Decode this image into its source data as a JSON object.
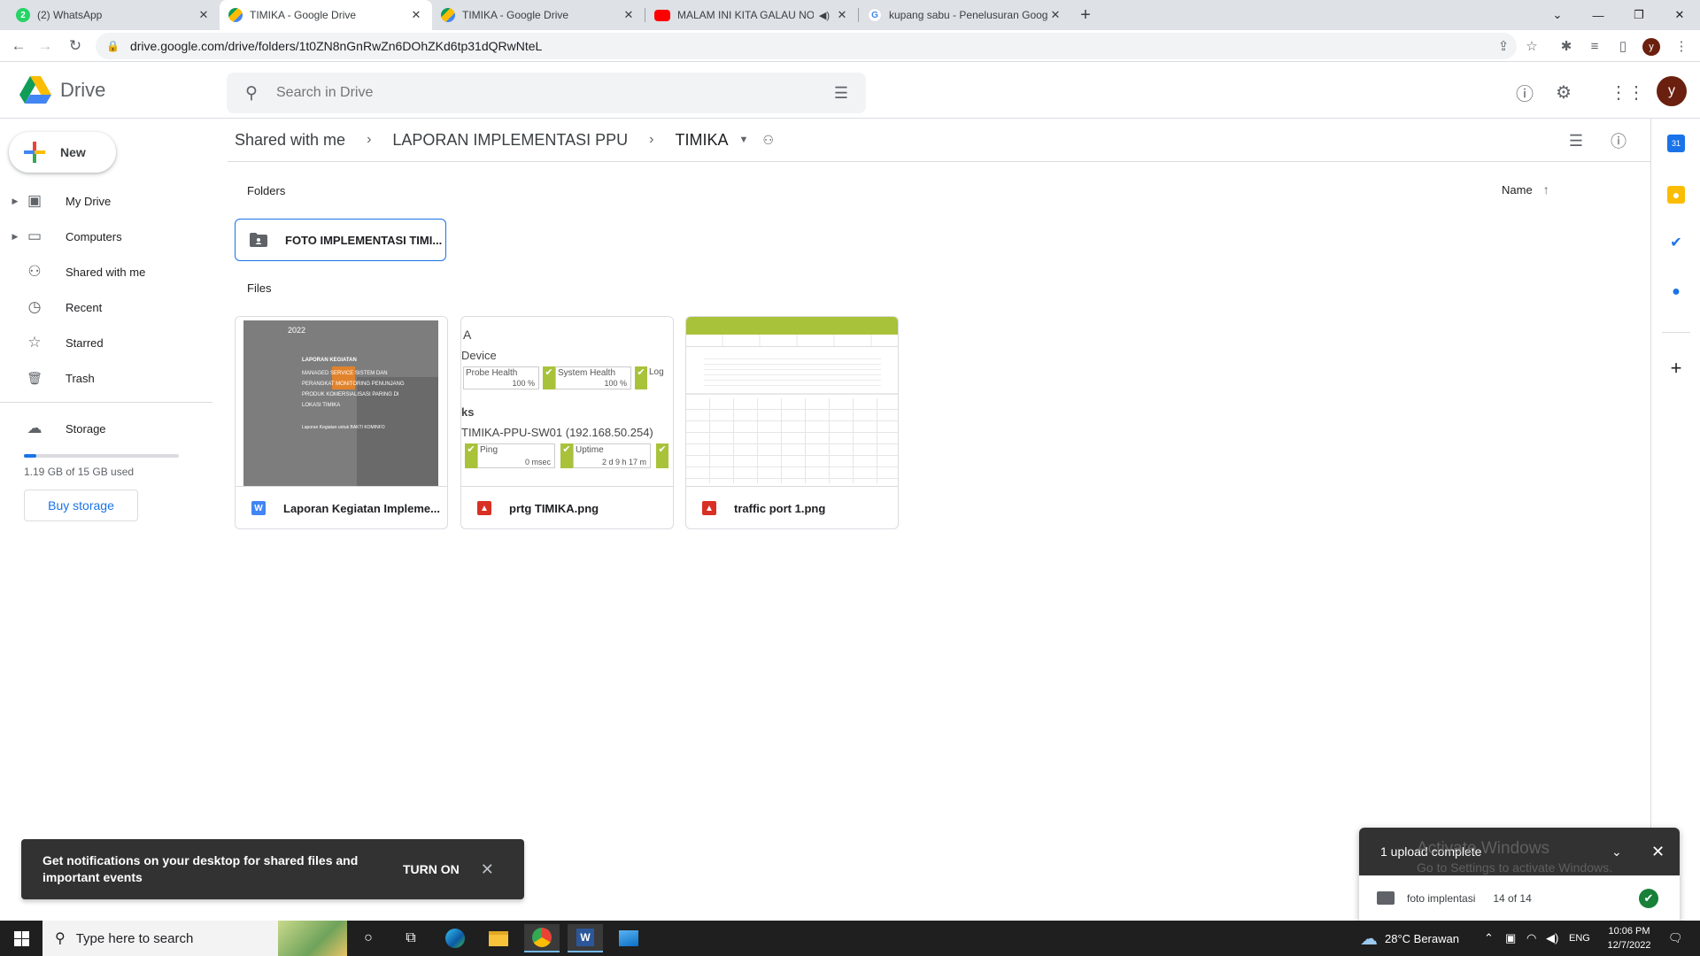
{
  "browser": {
    "tabs": [
      {
        "title": "(2) WhatsApp",
        "favicon_color": "#25d366",
        "favicon_text": "2",
        "active": false
      },
      {
        "title": "TIMIKA - Google Drive",
        "favicon_color": "#1a73e8",
        "favicon_text": "",
        "active": true
      },
      {
        "title": "TIMIKA - Google Drive",
        "favicon_color": "#1a73e8",
        "favicon_text": "",
        "active": false
      },
      {
        "title": "MALAM INI KITA GALAU NO",
        "favicon_color": "#ff0000",
        "favicon_text": "",
        "active": false
      },
      {
        "title": "kupang sabu - Penelusuran Goog",
        "favicon_color": "#ffffff",
        "favicon_text": "G",
        "active": false
      }
    ],
    "url": "drive.google.com/drive/folders/1t0ZN8nGnRwZn6DOhZKd6tp31dQRwNteL",
    "profile_initial": "y"
  },
  "drive": {
    "logo_text": "Drive",
    "search_placeholder": "Search in Drive",
    "avatar_initial": "y",
    "new_label": "New",
    "nav": [
      {
        "label": "My Drive",
        "icon": "my-drive-icon",
        "glyph": "▣",
        "caret": true
      },
      {
        "label": "Computers",
        "icon": "computer-icon",
        "glyph": "▭",
        "caret": true
      },
      {
        "label": "Shared with me",
        "icon": "shared-icon",
        "glyph": "⚇",
        "caret": false
      },
      {
        "label": "Recent",
        "icon": "clock-icon",
        "glyph": "◷",
        "caret": false
      },
      {
        "label": "Starred",
        "icon": "star-icon",
        "glyph": "☆",
        "caret": false
      },
      {
        "label": "Trash",
        "icon": "trash-icon",
        "glyph": "🗑",
        "caret": false
      }
    ],
    "storage": {
      "label": "Storage",
      "used_text": "1.19 GB of 15 GB used",
      "used_fraction": 0.079,
      "buy_label": "Buy storage"
    },
    "breadcrumb": [
      "Shared with me",
      "LAPORAN IMPLEMENTASI PPU",
      "TIMIKA"
    ],
    "folders_label": "Folders",
    "files_label": "Files",
    "sort_label": "Name",
    "folders": [
      {
        "name": "FOTO IMPLEMENTASI TIMI..."
      }
    ],
    "files": [
      {
        "name": "Laporan Kegiatan Impleme...",
        "type": "word",
        "type_color": "#4285f4",
        "type_glyph": "W"
      },
      {
        "name": "prtg TIMIKA.png",
        "type": "image",
        "type_color": "#d93025",
        "type_glyph": "▲"
      },
      {
        "name": "traffic port 1.png",
        "type": "image",
        "type_color": "#d93025",
        "type_glyph": "▲"
      }
    ],
    "thumb_doc": {
      "year": "2022",
      "title": "LAPORAN KEGIATAN",
      "lines": [
        "MANAGED SERVICE SISTEM DAN",
        "PERANGKAT MONITORING PENUNJANG",
        "PRODUK KOMERSIALISASI PARING DI",
        "LOKASI TIMIKA"
      ],
      "footer": "Laporan Kegiatan untuk BAKTI KOMINFO"
    },
    "thumb_prtg": {
      "a": "A",
      "device": "Device",
      "probe": "Probe Health",
      "probe_val": "100 %",
      "system": "System Health",
      "system_val": "100 %",
      "log": "Log",
      "ks": "ks",
      "host": "TIMIKA-PPU-SW01 (192.168.50.254)",
      "ping": "Ping",
      "ping_val": "0 msec",
      "uptime": "Uptime",
      "uptime_val": "2 d 9 h 17 m"
    }
  },
  "snackbar": {
    "message": "Get notifications on your desktop for shared files and important events",
    "action": "TURN ON"
  },
  "upload": {
    "title": "1 upload complete",
    "item_name": "foto implentasi",
    "item_count": "14 of 14"
  },
  "watermark": {
    "line1": "Activate Windows",
    "line2": "Go to Settings to activate Windows."
  },
  "taskbar": {
    "search_placeholder": "Type here to search",
    "weather": "28°C  Berawan",
    "lang": "ENG",
    "time": "10:06 PM",
    "date": "12/7/2022"
  },
  "colors": {
    "accent": "#1a73e8",
    "word": "#4285f4",
    "image": "#d93025",
    "lime": "#a8c23a"
  }
}
